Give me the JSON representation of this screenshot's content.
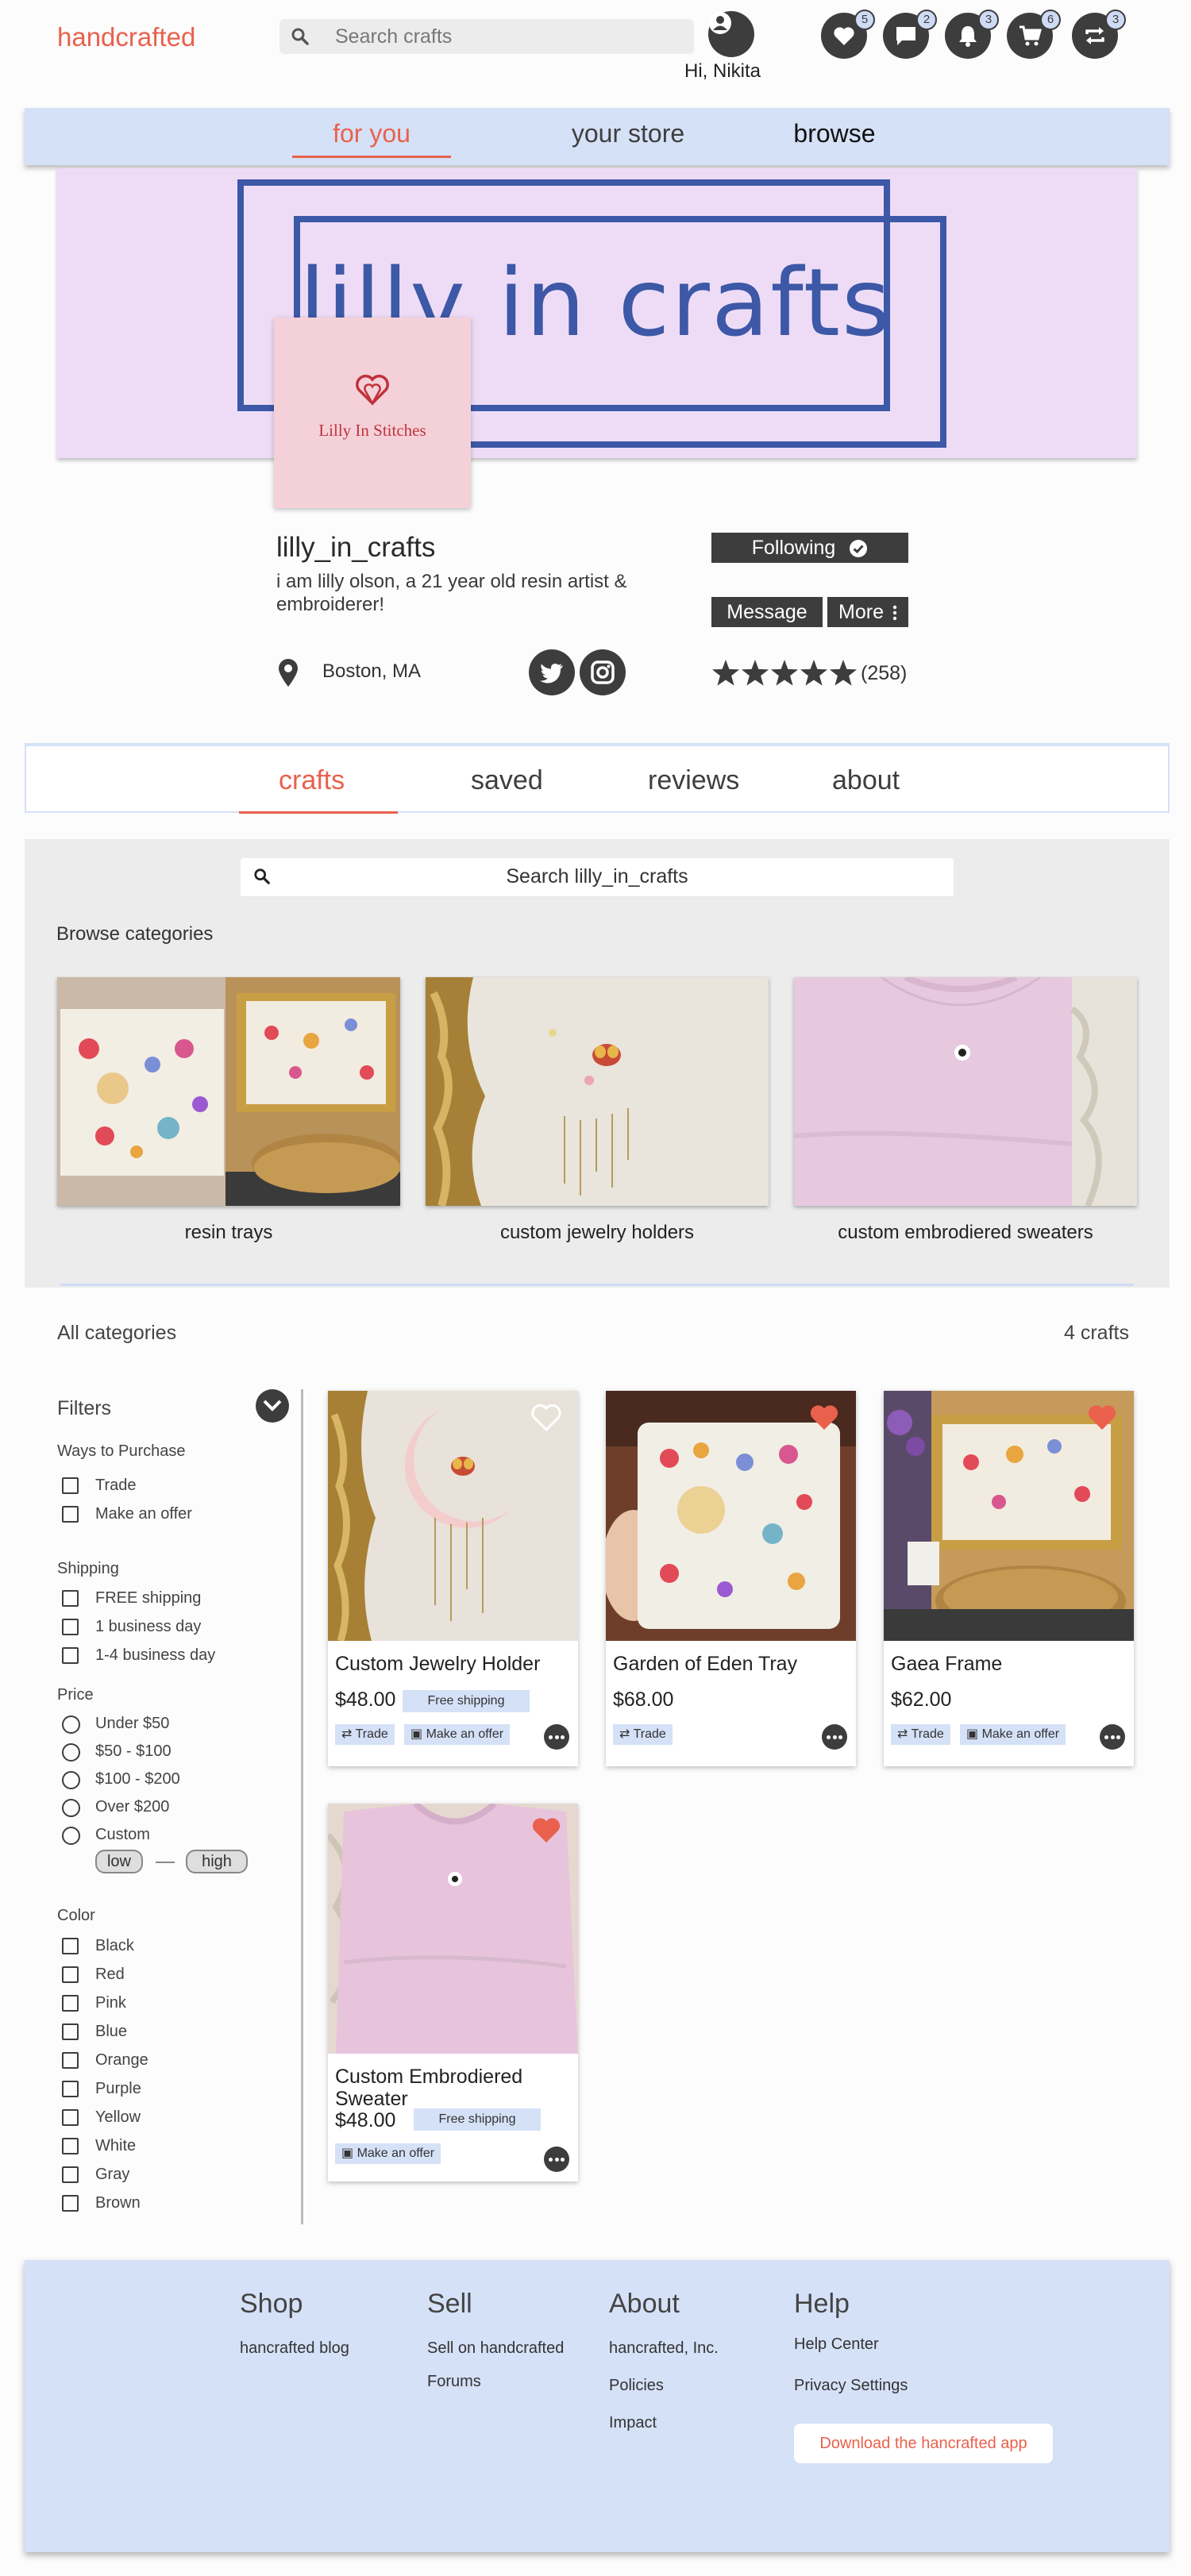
{
  "header": {
    "logo": "handcrafted",
    "search_placeholder": "Search crafts",
    "greeting": "Hi, Nikita",
    "badges": {
      "favorites": "5",
      "messages": "2",
      "notifications": "3",
      "cart": "6",
      "trades": "3"
    }
  },
  "topnav": {
    "items": [
      "for you",
      "your store",
      "browse"
    ],
    "active": "for you"
  },
  "banner": {
    "title": "lilly in crafts",
    "logo_text": "Lilly In Stitches"
  },
  "profile": {
    "username": "lilly_in_crafts",
    "bio": "i am lilly olson, a 21 year old resin artist & embroiderer!",
    "location": "Boston, MA",
    "following_label": "Following",
    "message_label": "Message",
    "more_label": "More",
    "rating_count": "(258)",
    "stars": 5
  },
  "tabs": {
    "items": [
      "crafts",
      "saved",
      "reviews",
      "about"
    ],
    "active": "crafts"
  },
  "browse": {
    "search_placeholder": "Search lilly_in_crafts",
    "heading": "Browse categories",
    "categories": [
      {
        "label": "resin trays"
      },
      {
        "label": "custom jewelry holders"
      },
      {
        "label": "custom embrodiered sweaters"
      }
    ]
  },
  "listing": {
    "heading": "All categories",
    "count": "4 crafts"
  },
  "filters": {
    "title": "Filters",
    "purchase": {
      "title": "Ways to Purchase",
      "options": [
        "Trade",
        "Make an offer"
      ]
    },
    "shipping": {
      "title": "Shipping",
      "options": [
        "FREE shipping",
        "1 business day",
        "1-4 business day"
      ]
    },
    "price": {
      "title": "Price",
      "options": [
        "Under $50",
        "$50 - $100",
        "$100 - $200",
        "Over $200",
        "Custom"
      ],
      "low": "low",
      "high": "high"
    },
    "color": {
      "title": "Color",
      "options": [
        "Black",
        "Red",
        "Pink",
        "Blue",
        "Orange",
        "Purple",
        "Yellow",
        "White",
        "Gray",
        "Brown"
      ]
    }
  },
  "products": [
    {
      "title": "Custom Jewelry Holder",
      "price": "$48.00",
      "shipping": "Free shipping",
      "tags": [
        "Trade",
        "Make an offer"
      ],
      "favorited": false
    },
    {
      "title": "Garden of Eden Tray",
      "price": "$68.00",
      "shipping": "",
      "tags": [
        "Trade"
      ],
      "favorited": true
    },
    {
      "title": "Gaea Frame",
      "price": "$62.00",
      "shipping": "",
      "tags": [
        "Trade",
        "Make an offer"
      ],
      "favorited": true
    },
    {
      "title": "Custom Embrodiered Sweater",
      "price": "$48.00",
      "shipping": "Free shipping",
      "tags": [
        "Make an offer"
      ],
      "favorited": true
    }
  ],
  "footer": {
    "shop": {
      "title": "Shop",
      "links": [
        "hancrafted blog"
      ]
    },
    "sell": {
      "title": "Sell",
      "links": [
        "Sell on handcrafted",
        "Forums"
      ]
    },
    "about": {
      "title": "About",
      "links": [
        "hancrafted, Inc.",
        "Policies",
        "Impact"
      ]
    },
    "help": {
      "title": "Help",
      "links": [
        "Help Center",
        "Privacy Settings"
      ]
    },
    "app_button": "Download the hancrafted app"
  },
  "colors": {
    "accent": "#e9614c",
    "nav_blue": "#d5e1f7",
    "dark": "#3d3d3d",
    "banner_bg": "#eedcf7",
    "banner_ink": "#3c58a6"
  }
}
